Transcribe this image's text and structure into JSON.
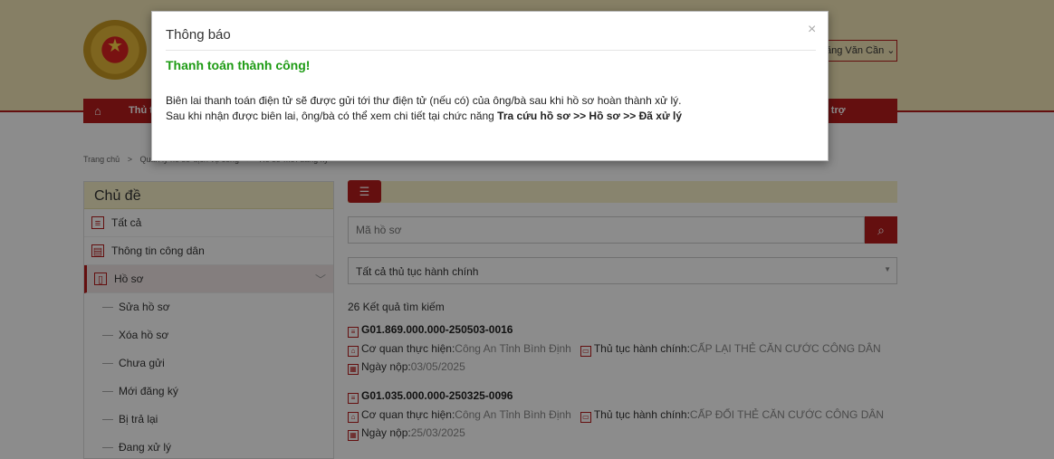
{
  "header": {
    "user_name": "ăng Văn Cần",
    "user_chevron": "⌄",
    "nav_home_icon": "home-icon",
    "nav_item_left": "Thủ t",
    "nav_item_right": "ỗ trợ"
  },
  "breadcrumb": {
    "home": "Trang chủ",
    "sep": ">",
    "level2": "Quản lý hồ sơ dịch vụ công",
    "level3": "Hồ sơ mới đăng ký"
  },
  "sidebar": {
    "title": "Chủ đề",
    "items": [
      {
        "label": "Tất cả",
        "icon": "list-icon"
      },
      {
        "label": "Thông tin công dân",
        "icon": "id-card-icon"
      },
      {
        "label": "Hồ sơ",
        "icon": "folder-icon",
        "active": true
      }
    ],
    "sub_items": [
      "Sửa hồ sơ",
      "Xóa hồ sơ",
      "Chưa gửi",
      "Mới đăng ký",
      "Bị trả lại",
      "Đang xử lý"
    ]
  },
  "search": {
    "placeholder": "Mã hồ sơ",
    "select_value": "Tất cả thủ tục hành chính"
  },
  "results": {
    "count_text": "26 Kết quả tìm kiếm",
    "records": [
      {
        "code": "G01.869.000.000-250503-0016",
        "agency_label": "Cơ quan thực hiện:",
        "agency_value": "Công An Tỉnh Bình Định",
        "procedure_label": "Thủ tục hành chính:",
        "procedure_value": "CẤP LẠI THẺ CĂN CƯỚC CÔNG DÂN",
        "date_label": "Ngày nộp:",
        "date_value": "03/05/2025"
      },
      {
        "code": "G01.035.000.000-250325-0096",
        "agency_label": "Cơ quan thực hiện:",
        "agency_value": "Công An Tỉnh Bình Định",
        "procedure_label": "Thủ tục hành chính:",
        "procedure_value": "CẤP ĐỔI THẺ CĂN CƯỚC CÔNG DÂN",
        "date_label": "Ngày nộp:",
        "date_value": "25/03/2025"
      }
    ]
  },
  "modal": {
    "title": "Thông báo",
    "close": "×",
    "success": "Thanh toán thành công!",
    "line1": "Biên lai thanh toán điện tử sẽ được gửi tới thư điện tử (nếu có) của ông/bà sau khi hồ sơ hoàn thành xử lý.",
    "line2_prefix": "Sau khi nhận được biên lai, ông/bà có thể xem chi tiết tại chức năng ",
    "line2_bold": "Tra cứu hồ sơ >> Hồ sơ >> Đã xử lý"
  }
}
